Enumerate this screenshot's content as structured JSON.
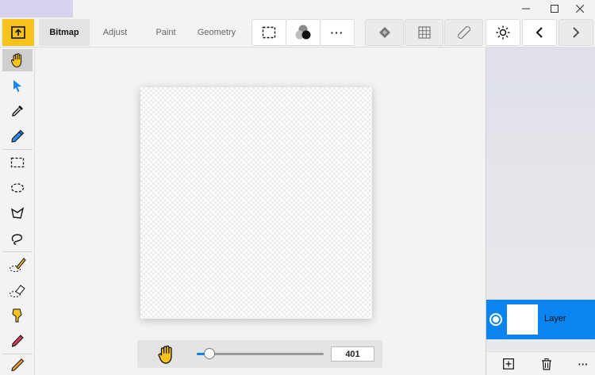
{
  "toolbar": {
    "tabs": [
      {
        "label": "Bitmap",
        "active": true
      },
      {
        "label": "Adjust",
        "active": false
      },
      {
        "label": "Paint",
        "active": false
      },
      {
        "label": "Geometry",
        "active": false
      }
    ],
    "more_label": "···",
    "accent_color": "#f7c31b"
  },
  "sidebar": {
    "tools": [
      "hand-icon",
      "pointer-icon",
      "eyedropper-icon",
      "color-dropper-icon",
      "rect-select-icon",
      "ellipse-select-icon",
      "polygon-lasso-icon",
      "lasso-icon",
      "brush-selection-icon",
      "eraser-selection-icon",
      "fill-icon",
      "pencil-icon",
      "pen-icon"
    ]
  },
  "zoom": {
    "value": "401",
    "level": 0.1
  },
  "layers": {
    "items": [
      {
        "name": "Layer",
        "selected": true
      }
    ],
    "more_label": "···",
    "selected_color": "#0a84f0"
  }
}
